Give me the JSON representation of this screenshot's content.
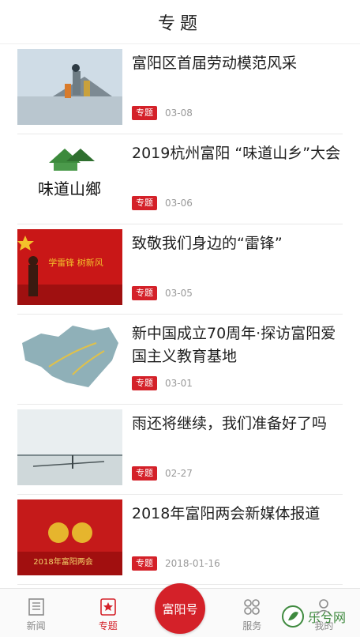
{
  "header": {
    "title": "专题"
  },
  "items": [
    {
      "title": "富阳区首届劳动模范风采",
      "tag": "专题",
      "date": "03-08"
    },
    {
      "title": "2019杭州富阳 “味道山乡”大会",
      "tag": "专题",
      "date": "03-06"
    },
    {
      "title": "致敬我们身边的“雷锋”",
      "tag": "专题",
      "date": "03-05"
    },
    {
      "title": "新中国成立70周年·探访富阳爱国主义教育基地",
      "tag": "专题",
      "date": "03-01"
    },
    {
      "title": "雨还将继续，我们准备好了吗",
      "tag": "专题",
      "date": "02-27"
    },
    {
      "title": "2018年富阳两会新媒体报道",
      "tag": "专题",
      "date": "2018-01-16"
    }
  ],
  "thumbs": {
    "t2_text": "味道山鄉",
    "t3_text": "学雷锋 树新风",
    "t6_text": "2018年富阳两会"
  },
  "tabbar": {
    "news": "新闻",
    "topic": "专题",
    "center": "富阳号",
    "service": "服务",
    "mine": "我的"
  },
  "watermark": {
    "text": "乐兮网"
  },
  "colors": {
    "accent": "#d42129",
    "muted": "#999999"
  }
}
